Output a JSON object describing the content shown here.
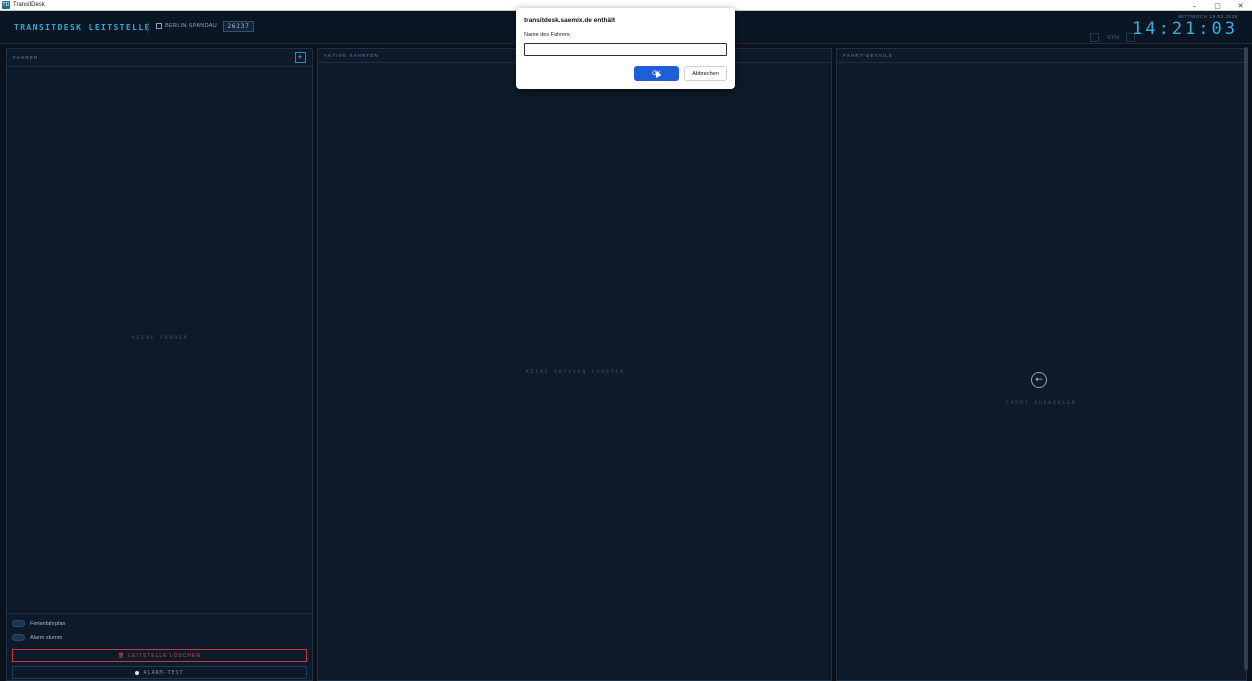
{
  "window": {
    "app_icon": "TD",
    "title": "TransitDesk",
    "controls": {
      "minimize": "–",
      "maximize": "▢",
      "close": "✕"
    }
  },
  "header": {
    "brand": "TRANSITDESK LEITSTELLE",
    "location": "BERLIN-SPANDAU",
    "location_icon": "building-icon",
    "code": "26237",
    "date": "MITTWOCH 18.03.2026",
    "clock": "14:21:03",
    "nav_label": "SYN"
  },
  "panels": {
    "drivers": {
      "title": "FAHRER",
      "add_symbol": "+",
      "empty": "KEINE FAHRER"
    },
    "active_trips": {
      "title": "AKTIVE FAHRTEN",
      "empty": "KEINE AKTIVEN FAHRTEN"
    },
    "trip_details": {
      "title": "FAHRT-DETAILS",
      "back_icon": "arrow-left-circle-icon",
      "back_symbol": "←",
      "empty": "FAHRT AUSWÄHLEN"
    }
  },
  "settings": {
    "holiday_schedule": "Ferienfahrplan",
    "mute_alarm": "Alarm stumm",
    "delete_button": "LEITSTELLE LÖSCHEN",
    "delete_icon": "trash-icon",
    "alarm_test": "ALARM-TEST"
  },
  "dialog": {
    "title": "transitdesk.saemix.de enthält",
    "label": "Name des Fahrers:",
    "input_value": "",
    "ok": "OK",
    "cancel": "Abbrechen"
  },
  "colors": {
    "accent": "#3aaee0",
    "danger": "#d94b52",
    "panel_bg": "#0e1a2a",
    "dialog_ok": "#1f5fd6"
  }
}
